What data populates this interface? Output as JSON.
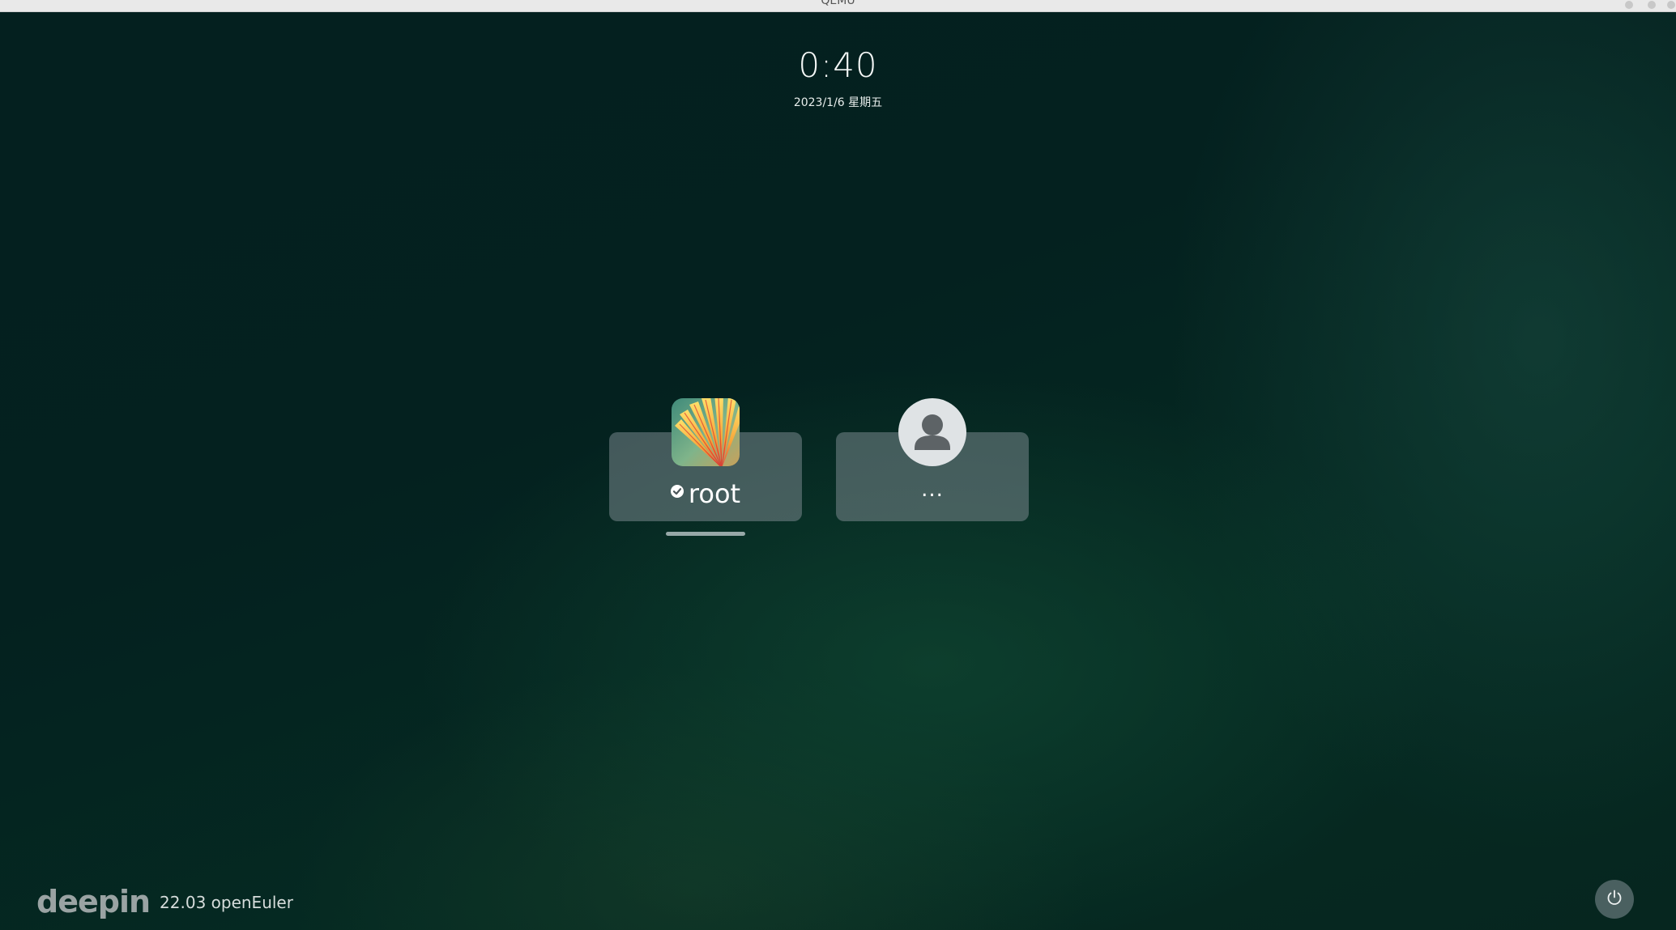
{
  "window": {
    "title": "QEMU"
  },
  "clock": {
    "time": "0:40",
    "date": "2023/1/6 星期五"
  },
  "users": [
    {
      "name": "root",
      "avatar_icon": "flower-avatar-icon",
      "logged_in_icon": "check-icon",
      "selected": true
    },
    {
      "name": "...",
      "avatar_icon": "user-silhouette-icon",
      "selected": false
    }
  ],
  "branding": {
    "logo": "deepin",
    "version": "22.03 openEuler"
  },
  "power": {
    "icon": "power-icon"
  },
  "colors": {
    "background": "#04211f",
    "card": "#5e6d70",
    "text": "#ffffff"
  }
}
